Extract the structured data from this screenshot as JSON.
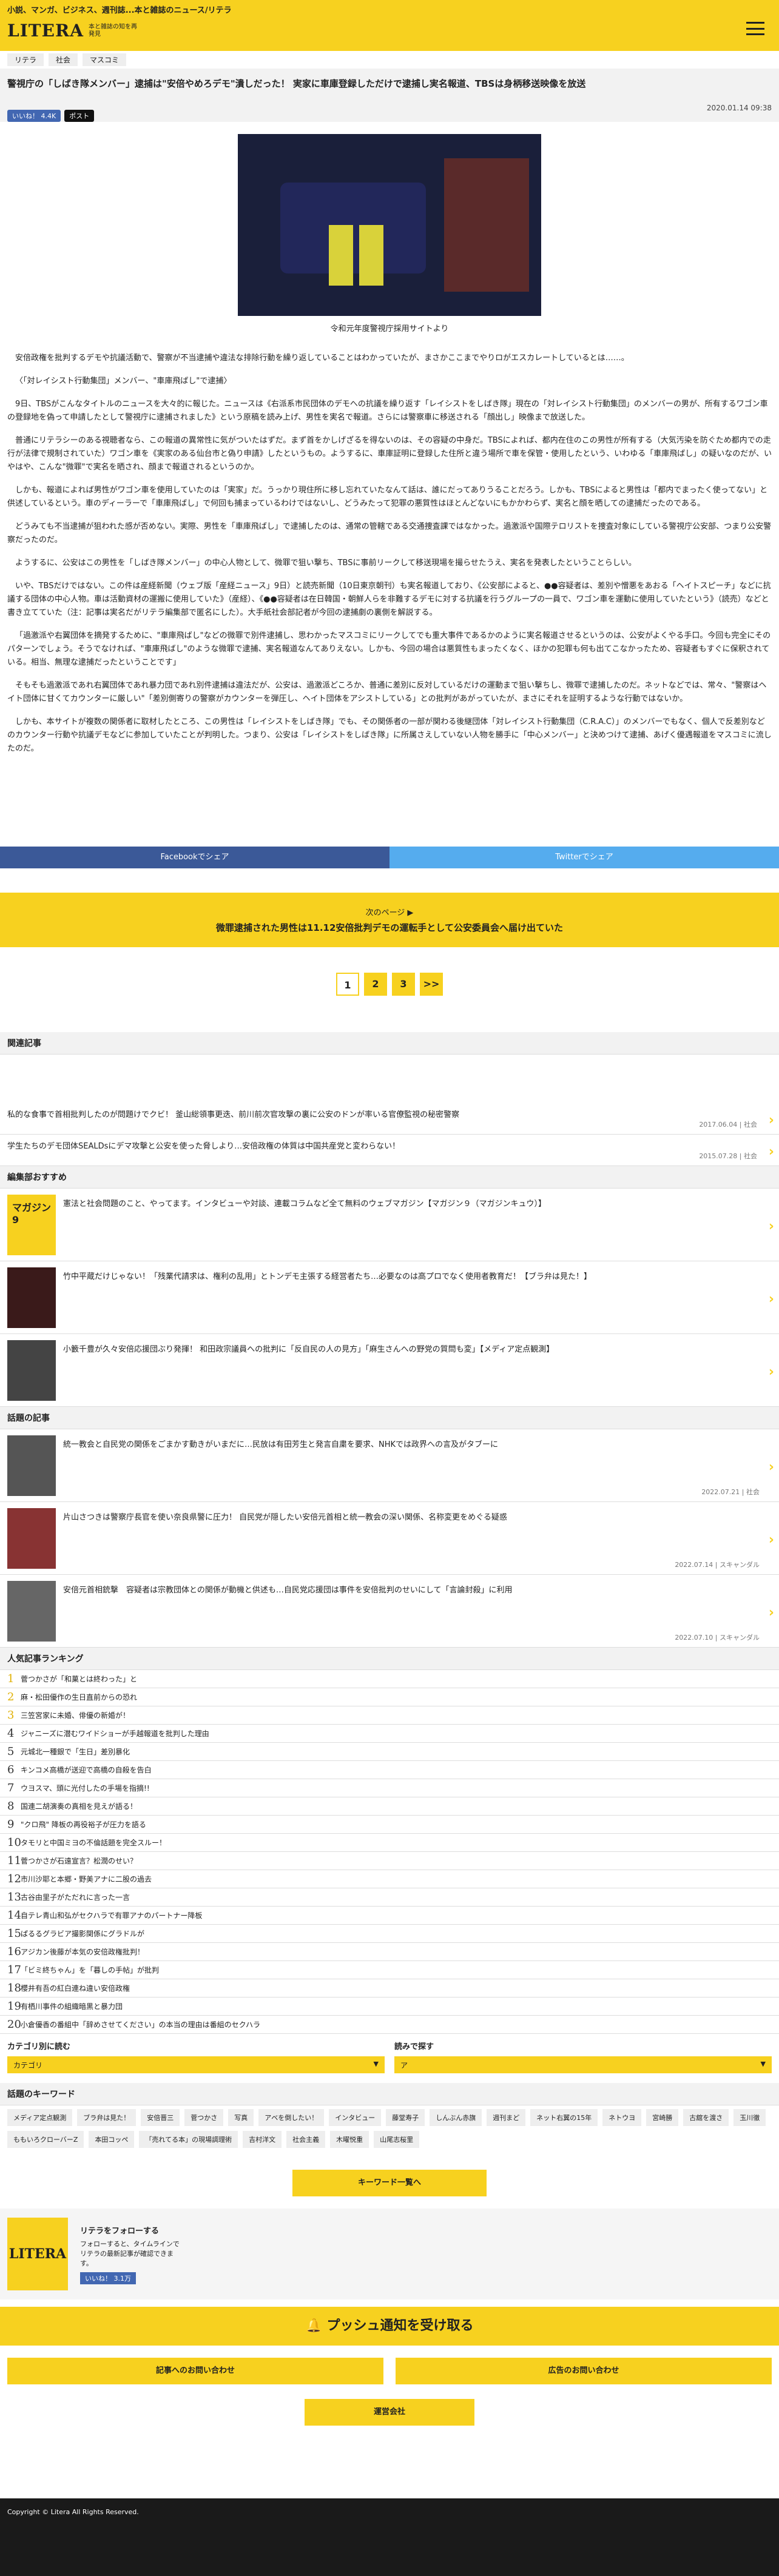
{
  "header": {
    "tagline": "小説、マンガ、ビジネス、週刊誌...本と雑誌のニュース/リテラ",
    "logo_text": "LITERA",
    "logo_sub": "本と雑誌の知を再発見"
  },
  "breadcrumbs": [
    "リテラ",
    "社会",
    "マスコミ"
  ],
  "article": {
    "title": "警視庁の「しばき隊メンバー」逮捕は\"安倍やめろデモ\"潰しだった！ 実家に車庫登録しただけで逮捕し実名報道、TBSは身柄移送映像を放送",
    "date": "2020.01.14 09:38",
    "like_label": "いいね！ 4.4K",
    "post_label": "ポスト",
    "photo_caption": "令和元年度警視庁採用サイトより",
    "paragraphs": [
      "安倍政権を批判するデモや抗議活動で、警察が不当逮捕や違法な排除行動を繰り返していることはわかっていたが、まさかここまでやりロがエスカレートしているとは……。",
      "〈「対レイシスト行動集団」メンバー、\"車庫飛ばし\"で逮捕〉",
      "9日、TBSがこんなタイトルのニュースを大々的に報じた。ニュースは《右派系市民団体のデモへの抗議を繰り返す「レイシストをしばき隊」現在の「対レイシスト行動集団」のメンバーの男が、所有するワゴン車の登録地を偽って申請したとして警視庁に逮捕されました》という原稿を読み上げ、男性を実名で報道。さらには警察車に移送される「顔出し」映像まで放送した。",
      "普通にリテラシーのある視聴者なら、この報道の異常性に気がついたはずだ。まず首をかしげざるを得ないのは、その容疑の中身だ。TBSによれば、都内在住のこの男性が所有する（大気汚染を防ぐため都内での走行が法律で規制されていた）ワゴン車を《実家のある仙台市と偽り申請》したというもの。ようするに、車庫証明に登録した住所と違う場所で車を保管・使用したという、いわゆる「車庫飛ばし」の疑いなのだが、いやはや、こんな\"微罪\"で実名を晒され、顔まで報道されるというのか。",
      "しかも、報道によれば男性がワゴン車を使用していたのは「実家」だ。うっかり現住所に移し忘れていたなんて話は、誰にだってありうることだろう。しかも、TBSによると男性は「都内でまったく使ってない」と供述しているという。車のディーラーで「車庫飛ばし」で何回も捕まっているわけではないし、どうみたって犯罪の悪質性はほとんどないにもかかわらず、実名と顔を晒しての逮捕だったのである。",
      "どうみても不当逮捕が狙われた感が否めない。実際、男性を「車庫飛ばし」で逮捕したのは、通常の管轄である交通捜査課ではなかった。過激派や国際テロリストを捜査対象にしている警視庁公安部、つまり公安警察だったのだ。",
      "ようするに、公安はこの男性を「しばき隊メンバー」の中心人物として、微罪で狙い撃ち、TBSに事前リークして移送現場を撮らせたうえ、実名を発表したということらしい。",
      "いや、TBSだけではない。この件は産経新聞（ウェブ版「産経ニュース」9日）と読売新聞（10日東京朝刊）も実名報道しており、《公安部によると、●●容疑者は、差別や憎悪をあおる「ヘイトスピーチ」などに抗議する団体の中心人物。車は活動資材の運搬に使用していた》（産経）、《●●容疑者は在日韓国・朝鮮人らを非難するデモに対する抗議を行うグループの一員で、ワゴン車を運動に使用していたという》（読売）などと書き立てていた（注：記事は実名だがリテラ編集部で匿名にした）。大手紙社会部記者が今回の逮捕劇の裏側を解説する。",
      "「過激派や右翼団体を摘発するために、\"車庫飛ばし\"などの微罪で別件逮捕し、思わかったマスコミにリークしてでも重大事件であるかのように実名報道させるというのは、公安がよくやる手口。今回も完全にそのパターンでしょう。そうでなければ、\"車庫飛ばし\"のような微罪で逮捕、実名報道なんてありえない。しかも、今回の場合は悪質性もまったくなく、ほかの犯罪も何も出てこなかったため、容疑者もすぐに保釈されている。相当、無理な逮捕だったということです」",
      "そもそも過激派であれ右翼団体であれ暴力団であれ別件逮捕は違法だが、公安は、過激派どころか、普通に差別に反対しているだけの運動まで狙い撃ちし、微罪で逮捕したのだ。ネットなどでは、常々、\"警察はヘイト団体に甘くてカウンターに厳しい\"「差別側寄りの警察がカウンターを弾圧し、ヘイト団体をアシストしている」との批判があがっていたが、まさにそれを証明するような行動ではないか。",
      "しかも、本サイトが複数の関係者に取材したところ、この男性は「レイシストをしばき隊」でも、その関係者の一部が関わる後継団体「対レイシスト行動集団（C.R.A.C）」のメンバーでもなく、個人で反差別などのカウンター行動や抗議デモなどに参加していたことが判明した。つまり、公安は「レイシストをしばき隊」に所属さえしていない人物を勝手に「中心メンバー」と決めつけて逮捕、あげく優遇報道をマスコミに流したのだ。"
    ]
  },
  "share": {
    "facebook": "Facebookでシェア",
    "twitter": "Twitterでシェア"
  },
  "next_page": {
    "label": "次のページ ▶",
    "title": "微罪逮捕された男性は11.12安倍批判デモの運転手として公安委員会へ届け出ていた"
  },
  "pagination": [
    "1",
    "2",
    "3",
    ">>"
  ],
  "related": {
    "heading": "関連記事",
    "items": [
      {
        "title": "私的な食事で首相批判したのが問題けでクビ！ 釜山総領事更迭、前川前次官攻撃の裏に公安のドンが率いる官僚監視の秘密警察",
        "meta": "2017.06.04 | 社会"
      },
      {
        "title": "学生たちのデモ団体SEALDsにデマ攻撃と公安を使った脅しより…安倍政権の体質は中国共産党と変わらない！",
        "meta": "2015.07.28 | 社会"
      }
    ]
  },
  "editors": {
    "heading": "編集部おすすめ",
    "items": [
      {
        "title": "憲法と社会問題のこと、やってます。インタビューや対談、連載コラムなど全て無料のウェブマガジン【マガジン９（マガジンキュウ）】",
        "thumb": "マガジン9",
        "thumb_color": "#f7d11f"
      },
      {
        "title": "竹中平蔵だけじゃない！「残業代請求は、権利の乱用」とトンデモ主張する経営者たち…必要なのは高プロでなく使用者教育だ！【ブラ弁は見た！】",
        "thumb": "",
        "thumb_color": "#3a1a1a"
      },
      {
        "title": "小籔千豊が久々安倍応援団ぶり発揮！ 和田政宗議員への批判に「反自民の人の見方」「麻生さんへの野党の質問も変」【メディア定点観測】",
        "thumb": "",
        "thumb_color": "#444444"
      }
    ]
  },
  "topical": {
    "heading": "話題の記事",
    "items": [
      {
        "title": "統一教会と自民党の関係をごまかす動きがいまだに…民放は有田芳生と発言自粛を要求、NHKでは政界への言及がタブーに",
        "meta": "2022.07.21 | 社会"
      },
      {
        "title": "片山さつきは警察庁長官を使い奈良県警に圧力！ 自民党が隠したい安倍元首相と統一教会の深い関係、名称変更をめぐる疑惑",
        "meta": "2022.07.14 | スキャンダル"
      },
      {
        "title": "安倍元首相銃撃　容疑者は宗教団体との関係が動機と供述も…自民党応援団は事件を安倍批判のせいにして「言論封殺」に利用",
        "meta": "2022.07.10 | スキャンダル"
      }
    ]
  },
  "ranking": {
    "heading": "人気記事ランキング",
    "items": [
      "菅つかさが「和菓とは終わった」と",
      "麻・松田優作の生日直前からの恐れ",
      "三笠宮家に未婚、俳優の新婚が！",
      "ジャニーズに潜むワイドショーが手越報道を批判した理由",
      "元城北一種銀で「生日」差別暴化",
      "キンコメ高橋が送迎で高橋の自殺を告白",
      "ウヨスマ、頭に光付したの手場を指摘!!",
      "国連二胡演奏の真相を見えが語る！",
      "\"クロ飛\" 降板の再役裕子が圧力を語る",
      "タモリと中国ミヨの不倫話題を完全スルー！",
      "菅つかさが石遠宣言？松潤のせい？",
      "市川沙耶と本郷・野美アナに二股の過去",
      "古谷由里子がただれに言った一言",
      "自テレ青山和弘がセクハラで有罪アナのパートナー降板",
      "ぱるるグラビア撮影関係にグラドルが",
      "アジカン後藤が本気の安倍政権批判！",
      "「ビミ終ちゃん」を「暮しの手帖」が批判",
      "櫻井有吾の紅白連ね違い安倍政権",
      "有栖川事件の組織暗黒と暴力団",
      "小倉優香の番組中「辞めさせてください」の本当の理由は番組のセクハラ"
    ]
  },
  "category_select": {
    "heading": "カテゴリ別に読む",
    "value": "カテゴリ"
  },
  "reading_select": {
    "heading": "読みで探す",
    "value": "ア"
  },
  "keywords": {
    "heading": "話題のキーワード",
    "items": [
      "メディア定点観測",
      "ブラ弁は見た！",
      "安倍晋三",
      "菅つかさ",
      "写真",
      "アベを倒したい！",
      "インタビュー",
      "藤堂寿子",
      "しんぶん赤旗",
      "週刊まど",
      "ネット右翼の15年",
      "ネトウヨ",
      "宮崎勝",
      "古舘を渡さ",
      "玉川徹",
      "ももいろクローバーZ",
      "本田コッペ",
      "「売れてる本」の現場調理術",
      "吉村洋文",
      "社会主義",
      "木曜悦重",
      "山尾志桜里"
    ],
    "more_label": "キーワード一覧へ"
  },
  "follow": {
    "logo": "LITERA",
    "heading": "リテラをフォローする",
    "desc": "フォローすると、タイムラインでリテラの最新記事が確認できます。",
    "like": "いいね！ 3.1万"
  },
  "push_label": "プッシュ通知を受け取る",
  "contact": {
    "article_inquiry": "記事へのお問い合わせ",
    "ad_inquiry": "広告のお問い合わせ",
    "company": "運営会社"
  },
  "footer": {
    "copyright": "Copyright © Litera All Rights Reserved."
  }
}
